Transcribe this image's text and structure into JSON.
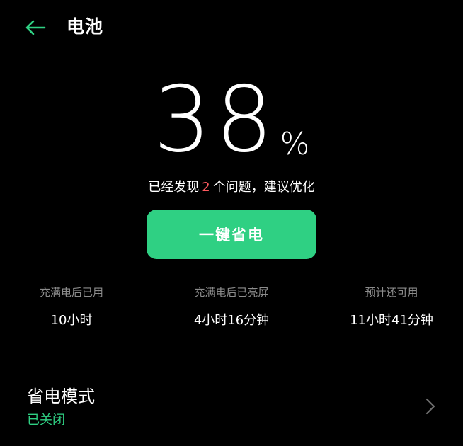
{
  "header": {
    "title": "电池"
  },
  "battery": {
    "percent": "38",
    "unit": "%"
  },
  "issues": {
    "prefix": "已经发现",
    "count": "2",
    "suffix": "个问题，建议优化"
  },
  "optimize_button": {
    "label": "一键省电"
  },
  "stats": [
    {
      "label": "充满电后已用",
      "value": "10小时"
    },
    {
      "label": "充满电后已亮屏",
      "value": "4小时16分钟"
    },
    {
      "label": "预计还可用",
      "value": "11小时41分钟"
    }
  ],
  "power_saving": {
    "title": "省电模式",
    "status": "已关闭"
  },
  "colors": {
    "background": "#000000",
    "accent_green": "#2fd083",
    "issue_red": "#ff5a5f",
    "secondary_text": "#8c8c8c"
  },
  "icons": {
    "back": "arrow-left-icon",
    "chevron": "chevron-right-icon"
  }
}
